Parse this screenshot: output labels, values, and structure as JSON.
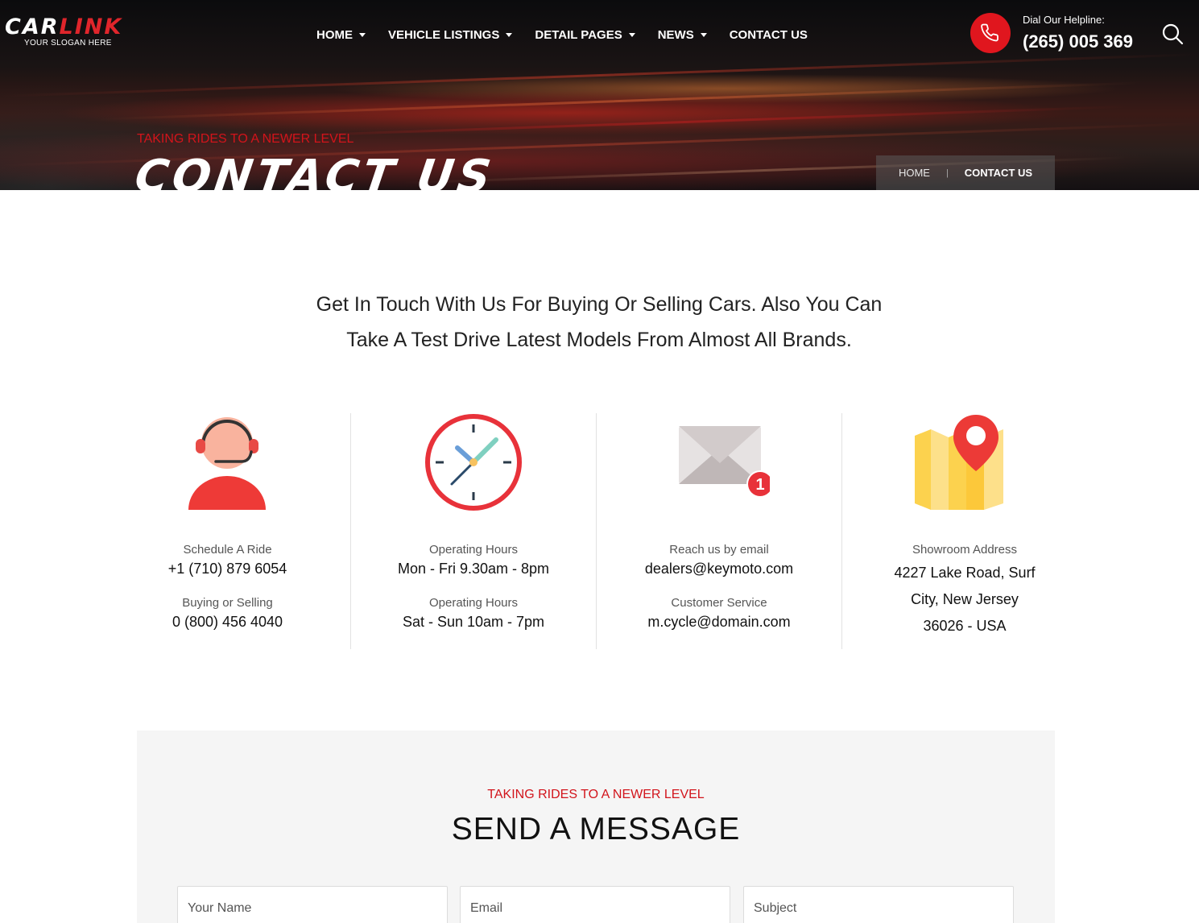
{
  "header": {
    "logo": {
      "part1": "CAR",
      "part2": "LINK",
      "slogan": "YOUR SLOGAN HERE"
    },
    "nav": [
      {
        "label": "HOME",
        "dropdown": true
      },
      {
        "label": "VEHICLE LISTINGS",
        "dropdown": true
      },
      {
        "label": "DETAIL PAGES",
        "dropdown": true
      },
      {
        "label": "NEWS",
        "dropdown": true
      },
      {
        "label": "CONTACT US",
        "dropdown": false
      }
    ],
    "helpline": {
      "label": "Dial Our Helpline:",
      "number": "(265) 005 369",
      "icon": "phone-icon"
    },
    "search_icon": "search-icon"
  },
  "hero": {
    "tagline": "TAKING RIDES TO A NEWER LEVEL",
    "title": "CONTACT US",
    "breadcrumb": {
      "home": "HOME",
      "separator": "|",
      "current": "CONTACT US"
    }
  },
  "intro": {
    "line1": "Get In Touch With Us For Buying Or Selling Cars. Also You Can",
    "line2": "Take A Test Drive Latest Models From Almost All Brands."
  },
  "info": [
    {
      "icon": "support-agent-icon",
      "label1": "Schedule A Ride",
      "value1": "+1 (710) 879 6054",
      "label2": "Buying or Selling",
      "value2": "0 (800) 456 4040"
    },
    {
      "icon": "clock-icon",
      "label1": "Operating Hours",
      "value1": "Mon - Fri 9.30am - 8pm",
      "label2": "Operating Hours",
      "value2": "Sat - Sun 10am - 7pm"
    },
    {
      "icon": "mail-notification-icon",
      "label1": "Reach us by email",
      "value1": "dealers@keymoto.com",
      "label2": "Customer Service",
      "value2": "m.cycle@domain.com",
      "badge": "1"
    },
    {
      "icon": "map-pin-icon",
      "label1": "Showroom Address",
      "address": [
        "4227 Lake Road, Surf",
        "City, New Jersey",
        "36026 - USA"
      ]
    }
  ],
  "form": {
    "tagline": "TAKING RIDES TO A NEWER LEVEL",
    "title": "SEND A MESSAGE",
    "name_placeholder": "Your Name",
    "email_placeholder": "Email",
    "subject_placeholder": "Subject"
  },
  "colors": {
    "accent": "#e0161e",
    "accent_text": "#d2141b",
    "hero_dark": "#141012",
    "form_bg": "#f5f5f5"
  }
}
